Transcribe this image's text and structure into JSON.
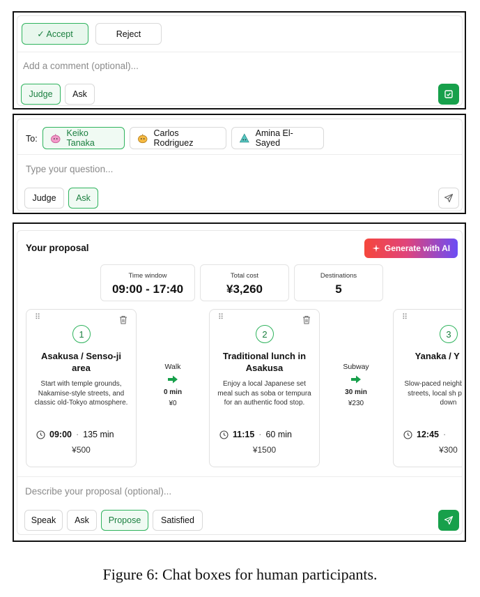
{
  "panel1": {
    "accept_label": "✓ Accept",
    "reject_label": "Reject",
    "comment_placeholder": "Add a comment (optional)...",
    "judge_label": "Judge",
    "ask_label": "Ask"
  },
  "panel2": {
    "to_label": "To:",
    "recipients": [
      {
        "name": "Keiko Tanaka",
        "active": true
      },
      {
        "name": "Carlos Rodriguez",
        "active": false
      },
      {
        "name": "Amina El-Sayed",
        "active": false
      }
    ],
    "question_placeholder": "Type your question...",
    "judge_label": "Judge",
    "ask_label": "Ask"
  },
  "panel3": {
    "title": "Your proposal",
    "generate_label": "Generate with AI",
    "stats": [
      {
        "label": "Time window",
        "value": "09:00 - 17:40"
      },
      {
        "label": "Total cost",
        "value": "¥3,260"
      },
      {
        "label": "Destinations",
        "value": "5"
      }
    ],
    "cards": [
      {
        "number": "1",
        "title": "Asakusa / Senso-ji area",
        "description": "Start with temple grounds, Nakamise-style streets, and classic old-Tokyo atmosphere.",
        "time": "09:00",
        "duration": "135 min",
        "price": "¥500"
      },
      {
        "number": "2",
        "title": "Traditional lunch in Asakusa",
        "description": "Enjoy a local Japanese set meal such as soba or tempura for an authentic food stop.",
        "time": "11:15",
        "duration": "60 min",
        "price": "¥1500"
      },
      {
        "number": "3",
        "title": "Yanaka / Y Ginz",
        "description": "Slow-paced neighborhood w streets, local sh preserved down",
        "time": "12:45",
        "duration": "",
        "price": "¥300"
      }
    ],
    "transits": [
      {
        "mode": "Walk",
        "minutes": "0 min",
        "cost": "¥0"
      },
      {
        "mode": "Subway",
        "minutes": "30 min",
        "cost": "¥230"
      }
    ],
    "proposal_placeholder": "Describe your proposal (optional)...",
    "actions": [
      "Speak",
      "Ask",
      "Propose",
      "Satisfied"
    ]
  },
  "caption": "Figure 6: Chat boxes for human participants.",
  "colors": {
    "accent_green": "#17a04b",
    "active_border": "#2fb35d",
    "gradient_start": "#f5473c",
    "gradient_end": "#6b4cf5"
  }
}
